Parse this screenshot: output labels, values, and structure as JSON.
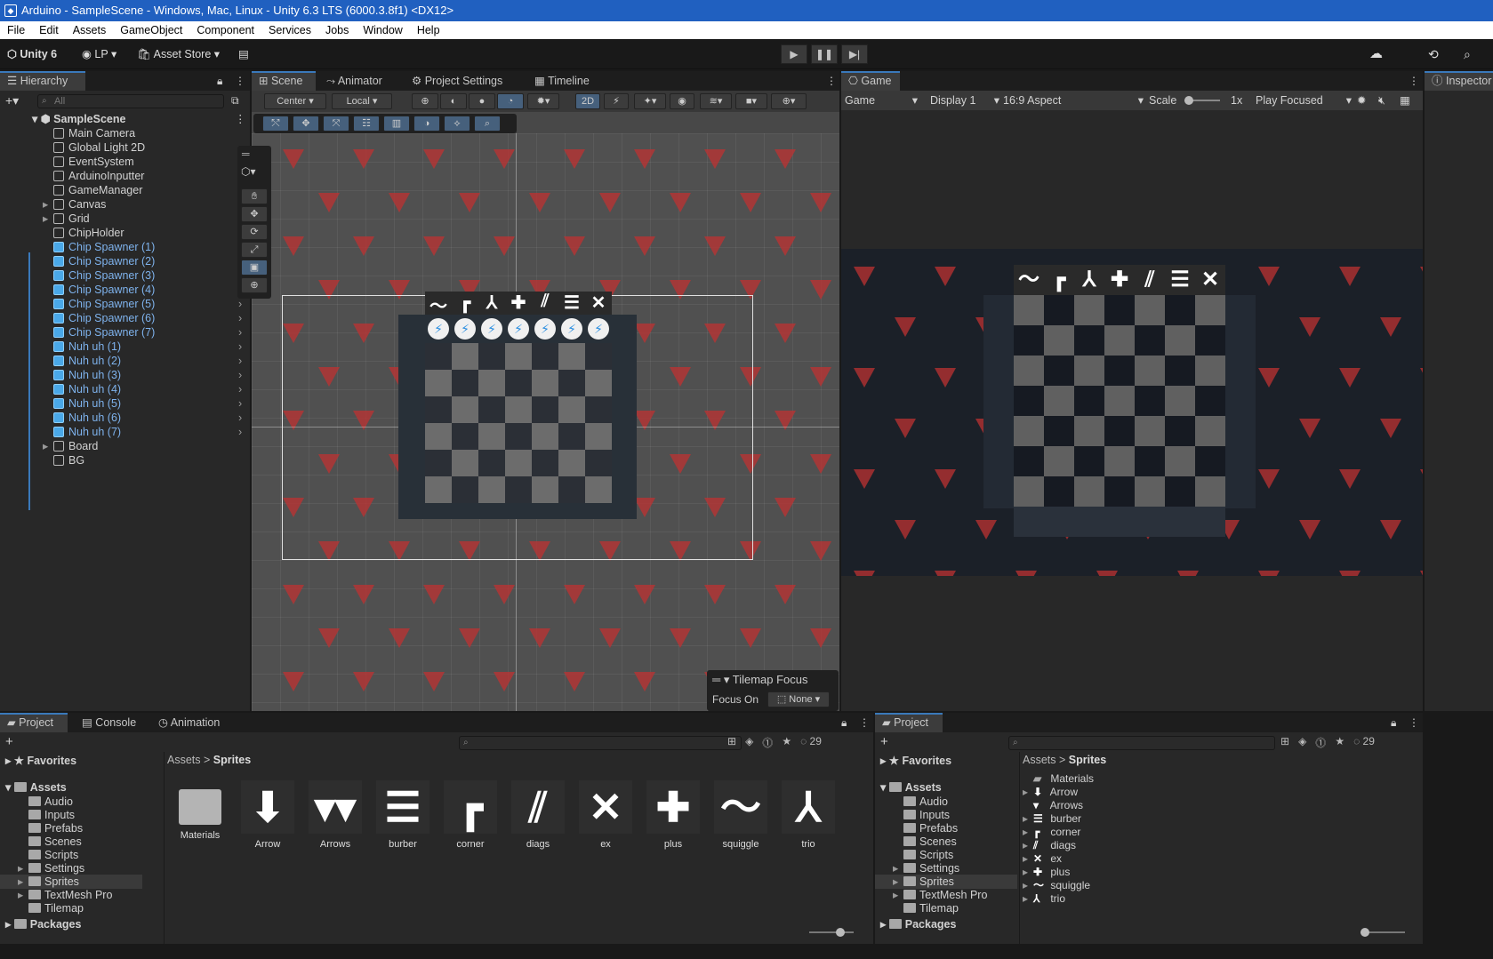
{
  "window": {
    "title": "Arduino - SampleScene - Windows, Mac, Linux - Unity 6.3 LTS (6000.3.8f1) <DX12>"
  },
  "menu": [
    "File",
    "Edit",
    "Assets",
    "GameObject",
    "Component",
    "Services",
    "Jobs",
    "Window",
    "Help"
  ],
  "toolbar": {
    "unity_label": "Unity 6",
    "account": "LP",
    "asset_store": "Asset Store"
  },
  "colors": {
    "accent": "#3a79bb",
    "selection_text": "#7eb2ec",
    "titlebar": "#2060c0",
    "triangle_red": "#be3232"
  },
  "hierarchy": {
    "tab": "Hierarchy",
    "search_placeholder": "All",
    "scene": "SampleScene",
    "items": [
      {
        "label": "Main Camera",
        "expandable": false,
        "selected": false
      },
      {
        "label": "Global Light 2D",
        "expandable": false,
        "selected": false
      },
      {
        "label": "EventSystem",
        "expandable": false,
        "selected": false
      },
      {
        "label": "ArduinoInputter",
        "expandable": false,
        "selected": false
      },
      {
        "label": "GameManager",
        "expandable": false,
        "selected": false
      },
      {
        "label": "Canvas",
        "expandable": true,
        "selected": false
      },
      {
        "label": "Grid",
        "expandable": true,
        "selected": false
      },
      {
        "label": "ChipHolder",
        "expandable": false,
        "selected": false
      },
      {
        "label": "Chip Spawner (1)",
        "expandable": false,
        "selected": true
      },
      {
        "label": "Chip Spawner (2)",
        "expandable": false,
        "selected": true
      },
      {
        "label": "Chip Spawner (3)",
        "expandable": false,
        "selected": true
      },
      {
        "label": "Chip Spawner (4)",
        "expandable": false,
        "selected": true
      },
      {
        "label": "Chip Spawner (5)",
        "expandable": false,
        "selected": true
      },
      {
        "label": "Chip Spawner (6)",
        "expandable": false,
        "selected": true
      },
      {
        "label": "Chip Spawner (7)",
        "expandable": false,
        "selected": true
      },
      {
        "label": "Nuh uh (1)",
        "expandable": false,
        "selected": true
      },
      {
        "label": "Nuh uh (2)",
        "expandable": false,
        "selected": true
      },
      {
        "label": "Nuh uh (3)",
        "expandable": false,
        "selected": true
      },
      {
        "label": "Nuh uh (4)",
        "expandable": false,
        "selected": true
      },
      {
        "label": "Nuh uh (5)",
        "expandable": false,
        "selected": true
      },
      {
        "label": "Nuh uh (6)",
        "expandable": false,
        "selected": true
      },
      {
        "label": "Nuh uh (7)",
        "expandable": false,
        "selected": true
      },
      {
        "label": "Board",
        "expandable": true,
        "selected": false
      },
      {
        "label": "BG",
        "expandable": false,
        "selected": false
      }
    ]
  },
  "scene_tabs": [
    "Scene",
    "Animator",
    "Project Settings",
    "Timeline"
  ],
  "scene_toolbar": {
    "pivot": "Center",
    "space": "Local",
    "mode_2d": "2D"
  },
  "tilemap_focus": {
    "title": "Tilemap Focus",
    "label": "Focus On",
    "value": "None"
  },
  "game": {
    "tab": "Game",
    "view": "Game",
    "display": "Display 1",
    "aspect": "16:9 Aspect",
    "scale_label": "Scale",
    "scale_value": "1x",
    "play_mode": "Play Focused"
  },
  "inspector": {
    "tab": "Inspector"
  },
  "bottom_tabs": [
    "Project",
    "Console",
    "Animation"
  ],
  "project_left": {
    "count": "29",
    "favorites": "Favorites",
    "assets": "Assets",
    "folders": [
      {
        "label": "Audio",
        "expandable": false
      },
      {
        "label": "Inputs",
        "expandable": false
      },
      {
        "label": "Prefabs",
        "expandable": false
      },
      {
        "label": "Scenes",
        "expandable": false
      },
      {
        "label": "Scripts",
        "expandable": false
      },
      {
        "label": "Settings",
        "expandable": true
      },
      {
        "label": "Sprites",
        "expandable": true
      },
      {
        "label": "TextMesh Pro",
        "expandable": true
      },
      {
        "label": "Tilemap",
        "expandable": false
      }
    ],
    "packages": "Packages",
    "breadcrumb": [
      "Assets",
      "Sprites"
    ],
    "items": [
      "Materials",
      "Arrow",
      "Arrows",
      "burber",
      "corner",
      "diags",
      "ex",
      "plus",
      "squiggle",
      "trio"
    ]
  },
  "project_right": {
    "tab": "Project",
    "count": "29",
    "list": [
      "Materials",
      "Arrow",
      "Arrows",
      "burber",
      "corner",
      "diags",
      "ex",
      "plus",
      "squiggle",
      "trio"
    ]
  }
}
